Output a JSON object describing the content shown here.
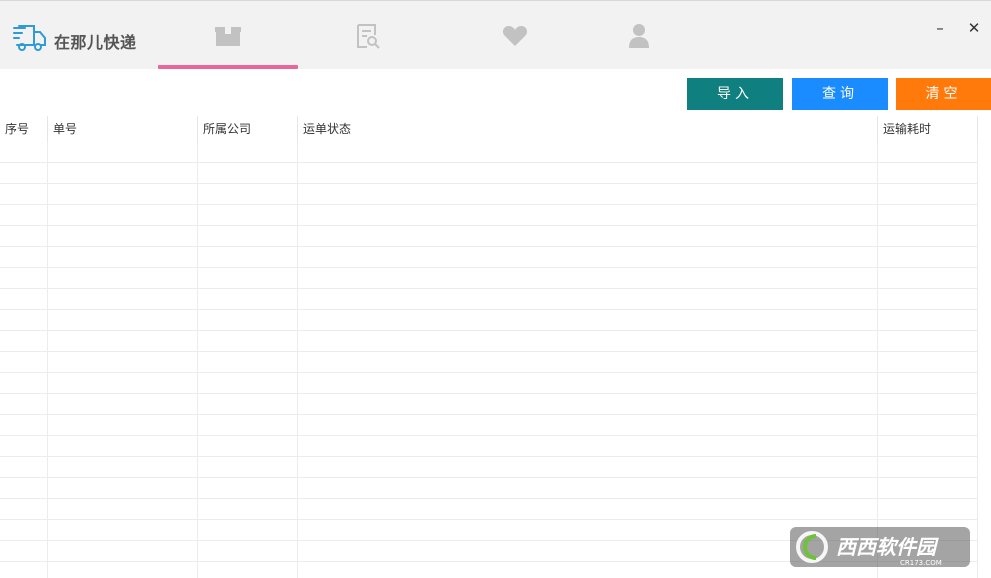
{
  "app": {
    "title": "在那儿快递"
  },
  "tabs": [
    {
      "icon": "package-icon",
      "active": true
    },
    {
      "icon": "document-search-icon",
      "active": false
    },
    {
      "icon": "heart-icon",
      "active": false
    },
    {
      "icon": "user-icon",
      "active": false
    }
  ],
  "window_controls": {
    "minimize": "–",
    "close": "✕"
  },
  "toolbar": {
    "import_label": "导入",
    "query_label": "查询",
    "clear_label": "清空"
  },
  "table": {
    "columns": [
      "序号",
      "单号",
      "所属公司",
      "运单状态",
      "运输耗时"
    ],
    "rows": []
  },
  "watermark": {
    "brand": "西西软件园",
    "url": "CR173.COM"
  },
  "colors": {
    "import": "#0f7f7f",
    "query": "#1a8cff",
    "clear": "#ff7a0a",
    "tab_underline": "#e8669a",
    "logo": "#2e9ad6"
  }
}
